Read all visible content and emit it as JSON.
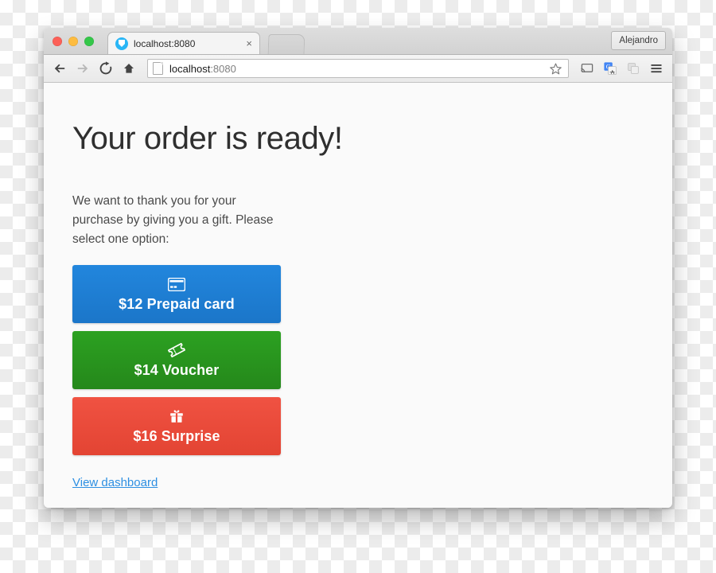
{
  "browser": {
    "window_controls": [
      {
        "name": "close",
        "color": "#fc6058"
      },
      {
        "name": "minimize",
        "color": "#fdbc40"
      },
      {
        "name": "maximize",
        "color": "#34c749"
      }
    ],
    "tab": {
      "title": "localhost:8080",
      "favicon": "shield-favicon",
      "close_label": "×"
    },
    "new_tab_label": "",
    "profile_label": "Alejandro",
    "toolbar": {
      "back_icon": "back-arrow-icon",
      "forward_icon": "forward-arrow-icon",
      "reload_icon": "reload-icon",
      "home_icon": "home-icon",
      "bookmark_icon": "star-icon",
      "cast_icon": "cast-icon",
      "translate_icon": "google-translate-icon",
      "extension_icon": "extension-icon",
      "menu_icon": "hamburger-menu-icon"
    },
    "url": {
      "host": "localhost",
      "port": ":8080",
      "full": "localhost:8080",
      "page_icon": "document-icon"
    }
  },
  "page": {
    "title": "Your order is ready!",
    "intro": "We want to thank you for your purchase by giving you a gift. Please select one option:",
    "options": [
      {
        "label": "$12 Prepaid card",
        "amount": "$12",
        "icon": "credit-card-icon",
        "color": "#1f7fd6",
        "color_bottom": "#1b76c9",
        "name": "prepaid-card"
      },
      {
        "label": "$14 Voucher",
        "amount": "$14",
        "icon": "ticket-icon",
        "color": "#2a9a1f",
        "color_bottom": "#25881b",
        "name": "voucher"
      },
      {
        "label": "$16 Surprise",
        "amount": "$16",
        "icon": "gift-icon",
        "color": "#ee4b3a",
        "color_bottom": "#e34433",
        "name": "surprise"
      }
    ],
    "dashboard_link": "View dashboard",
    "link_color": "#2d8fe2"
  }
}
